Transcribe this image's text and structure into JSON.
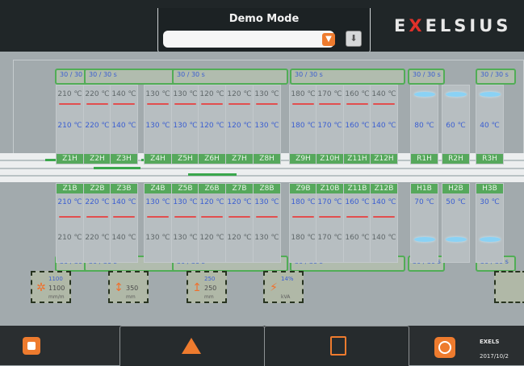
{
  "header": {
    "mode_title": "Demo Mode",
    "mode_select_value": "",
    "brand_prefix": "E",
    "brand_x": "X",
    "brand_rest": "ELSIUS"
  },
  "upper": {
    "groups": [
      {
        "label": "30 / 30 s"
      },
      {
        "label": "30 / 30 s"
      },
      {
        "label": "30 / 30 s"
      },
      {
        "label": "30 / 30 s"
      },
      {
        "label": "30 / 30 s"
      },
      {
        "label": "30 / 30 s"
      }
    ],
    "zones": [
      {
        "set": "210 ℃",
        "act": "210 ℃",
        "name": "Z1H"
      },
      {
        "set": "220 ℃",
        "act": "220 ℃",
        "name": "Z2H"
      },
      {
        "set": "140 ℃",
        "act": "140 ℃",
        "name": "Z3H"
      },
      {
        "set": "130 ℃",
        "act": "130 ℃",
        "name": "Z4H"
      },
      {
        "set": "130 ℃",
        "act": "130 ℃",
        "name": "Z5H"
      },
      {
        "set": "120 ℃",
        "act": "120 ℃",
        "name": "Z6H"
      },
      {
        "set": "120 ℃",
        "act": "120 ℃",
        "name": "Z7H"
      },
      {
        "set": "130 ℃",
        "act": "130 ℃",
        "name": "Z8H"
      },
      {
        "set": "180 ℃",
        "act": "180 ℃",
        "name": "Z9H"
      },
      {
        "set": "170 ℃",
        "act": "170 ℃",
        "name": "Z10H"
      },
      {
        "set": "160 ℃",
        "act": "160 ℃",
        "name": "Z11H"
      },
      {
        "set": "140 ℃",
        "act": "140 ℃",
        "name": "Z12H"
      },
      {
        "set": "",
        "act": "80 ℃",
        "name": "R1H"
      },
      {
        "set": "",
        "act": "60 ℃",
        "name": "R2H"
      },
      {
        "set": "",
        "act": "40 ℃",
        "name": "R3H"
      }
    ]
  },
  "lower": {
    "groups": [
      {
        "label": "30 / 30 s"
      },
      {
        "label": "30 / 30 s"
      },
      {
        "label": "30 / 30 s"
      },
      {
        "label": "30 / 30 s"
      },
      {
        "label": "30 / 30 s"
      },
      {
        "label": "30 / 30 s"
      }
    ],
    "zones": [
      {
        "set": "210 ℃",
        "act": "210 ℃",
        "name": "Z1B"
      },
      {
        "set": "220 ℃",
        "act": "220 ℃",
        "name": "Z2B"
      },
      {
        "set": "140 ℃",
        "act": "140 ℃",
        "name": "Z3B"
      },
      {
        "set": "130 ℃",
        "act": "130 ℃",
        "name": "Z4B"
      },
      {
        "set": "130 ℃",
        "act": "130 ℃",
        "name": "Z5B"
      },
      {
        "set": "120 ℃",
        "act": "120 ℃",
        "name": "Z6B"
      },
      {
        "set": "120 ℃",
        "act": "120 ℃",
        "name": "Z7B"
      },
      {
        "set": "130 ℃",
        "act": "130 ℃",
        "name": "Z8B"
      },
      {
        "set": "180 ℃",
        "act": "180 ℃",
        "name": "Z9B"
      },
      {
        "set": "170 ℃",
        "act": "170 ℃",
        "name": "Z10B"
      },
      {
        "set": "160 ℃",
        "act": "160 ℃",
        "name": "Z11B"
      },
      {
        "set": "140 ℃",
        "act": "140 ℃",
        "name": "Z12B"
      },
      {
        "set": "",
        "act": "70 ℃",
        "name": "H1B"
      },
      {
        "set": "",
        "act": "50 ℃",
        "name": "H2B"
      },
      {
        "set": "",
        "act": "30 ℃",
        "name": "H3B"
      }
    ]
  },
  "widgets": [
    {
      "v1": "1100",
      "v2": "1100",
      "unit": "mm/m",
      "icon": "gear-icon",
      "glyph": "✲"
    },
    {
      "v1": "",
      "v2": "350",
      "unit": "mm",
      "icon": "width-adjust-icon",
      "glyph": "↕"
    },
    {
      "v1": "250",
      "v2": "250",
      "unit": "mm",
      "icon": "height-adjust-icon",
      "glyph": "↥"
    },
    {
      "v1": "14%",
      "v2": "",
      "unit": "kVA",
      "icon": "power-icon",
      "glyph": "⚡"
    },
    {
      "v1": "",
      "v2": "",
      "unit": "",
      "icon": "oxygen-icon",
      "glyph": ""
    }
  ],
  "footer": {
    "brand_short": "EXELS",
    "date": "2017/10/2"
  },
  "colors": {
    "accent_orange": "#ee7b2e",
    "zone_green": "#51ad56",
    "value_blue": "#3a5ed1",
    "header_dark": "#202628"
  }
}
